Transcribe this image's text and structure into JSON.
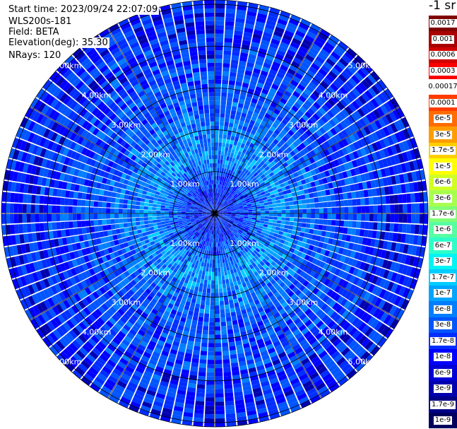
{
  "info": {
    "start_time": "Start time: 2023/09/24 22:07:09",
    "instrument": "WLS200s-181",
    "field": "Field: BETA",
    "elevation": "Elevation(deg): 35.30",
    "nrays": "NRays: 120"
  },
  "legend": {
    "title": "-1 sr",
    "entries": [
      {
        "label": "0.0017",
        "color": "#7f0000"
      },
      {
        "label": "0.001",
        "color": "#a80000"
      },
      {
        "label": "0.0006",
        "color": "#d00000"
      },
      {
        "label": "0.0003",
        "color": "#f80000"
      },
      {
        "label": "0.00017",
        "color": "#ffffff"
      },
      {
        "label": "0.0001",
        "color": "#ff3b00"
      },
      {
        "label": "6e-5",
        "color": "#ff6c00"
      },
      {
        "label": "3e-5",
        "color": "#ff9d00"
      },
      {
        "label": "1.7e-5",
        "color": "#ffce00"
      },
      {
        "label": "1e-5",
        "color": "#ffff00"
      },
      {
        "label": "6e-6",
        "color": "#d0ff26"
      },
      {
        "label": "3e-6",
        "color": "#a8ff4e"
      },
      {
        "label": "1.7e-6",
        "color": "#80ff77"
      },
      {
        "label": "1e-6",
        "color": "#56ffa0"
      },
      {
        "label": "6e-7",
        "color": "#2effc9"
      },
      {
        "label": "3e-7",
        "color": "#00f4f4"
      },
      {
        "label": "1.7e-7",
        "color": "#00cdff"
      },
      {
        "label": "1e-7",
        "color": "#00a5ff"
      },
      {
        "label": "6e-8",
        "color": "#007eff"
      },
      {
        "label": "3e-8",
        "color": "#0055ff"
      },
      {
        "label": "1.7e-8",
        "color": "#002eff"
      },
      {
        "label": "1e-8",
        "color": "#0000ff"
      },
      {
        "label": "6e-9",
        "color": "#0000d6"
      },
      {
        "label": "3e-9",
        "color": "#0000ae"
      },
      {
        "label": "1.7e-9",
        "color": "#000087"
      },
      {
        "label": "1e-9",
        "color": "#00005e"
      }
    ]
  },
  "chart_data": {
    "type": "heatmap",
    "projection": "polar (PPI scan)",
    "field": "BETA",
    "unit": "-1 sr",
    "range_rings_km": [
      1,
      2,
      3,
      4,
      5
    ],
    "ring_labels": [
      "1.00km",
      "2.00km",
      "3.00km",
      "4.00km",
      "5.00km"
    ],
    "max_range_km": 5.1,
    "spokes_deg": [
      0,
      30,
      60,
      90,
      120,
      150,
      180,
      210,
      240,
      270,
      300,
      330
    ],
    "n_rays": 120,
    "color_scale": "log",
    "value_range": [
      1e-09,
      0.0017
    ],
    "typical_values_by_range": [
      {
        "range_km": 0.5,
        "beta": 2e-08
      },
      {
        "range_km": 1.5,
        "beta": 1e-07
      },
      {
        "range_km": 2.5,
        "beta": 4e-08
      },
      {
        "range_km": 3.5,
        "beta": 3e-08
      },
      {
        "range_km": 4.5,
        "beta": 2e-08
      }
    ]
  }
}
